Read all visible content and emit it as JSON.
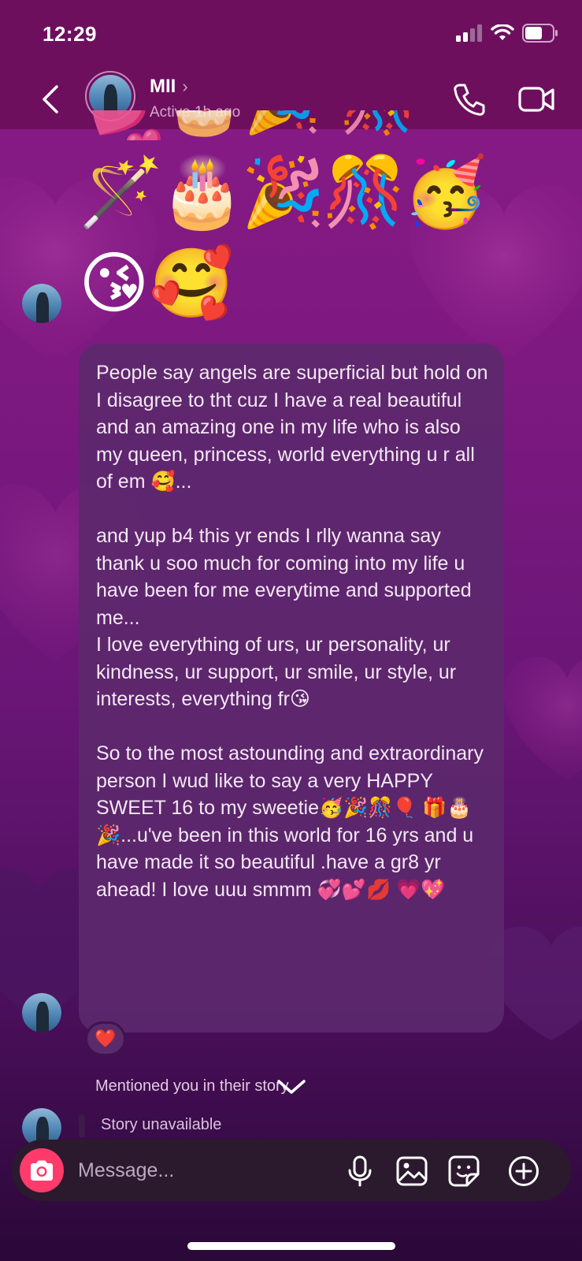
{
  "status_bar": {
    "time": "12:29"
  },
  "header": {
    "name": "MII",
    "chevron": "›",
    "status": "Active 1h ago"
  },
  "messages": {
    "emoji_line1": "🪄🎂🎉🎊🥳",
    "emoji_line2": "😘🥰",
    "top_peek": "💕🎂🎉 🎊💕",
    "bubble_text": "People say angels are superficial but hold on I disagree to tht cuz I have a real beautiful and an amazing one in my life who is also my queen, princess, world everything u r all of em 🥰...\n\nand yup b4 this yr ends I rlly wanna say thank u soo much for coming into my life u have been for me everytime and supported me...\nI love everything of urs, ur personality, ur kindness, ur support, ur smile, ur style, ur interests, everything fr😘\n\nSo to the most astounding and extraordinary person I wud like to say a very HAPPY SWEET 16 to my sweetie🥳🎉🎊🎈 🎁🎂🎉...u've been in this world for 16 yrs and u have made it so beautiful .have a gr8 yr ahead! I love uuu smmm 💞💕💋 💗💖",
    "reaction": "❤️",
    "mention": "Mentioned you in their story",
    "story_unavailable": "Story unavailable"
  },
  "composer": {
    "placeholder": "Message..."
  },
  "icons": [
    "back-icon",
    "phone-icon",
    "video-icon",
    "camera-icon",
    "microphone-icon",
    "gallery-icon",
    "sticker-icon",
    "plus-icon",
    "chevron-down-icon"
  ],
  "colors": {
    "background": "#7d1980",
    "header": "#6e0f5e",
    "bubble": "#5c286c",
    "camera_button": "#ff3b6b",
    "composer": "#2b1a2e"
  }
}
